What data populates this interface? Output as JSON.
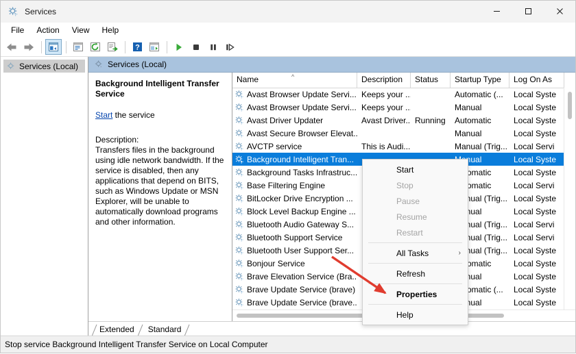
{
  "window": {
    "title": "Services",
    "icon": "services-gear-icon",
    "minimize_label": "Minimize",
    "maximize_label": "Maximize",
    "close_label": "Close"
  },
  "menubar": {
    "items": [
      {
        "label": "File"
      },
      {
        "label": "Action"
      },
      {
        "label": "View"
      },
      {
        "label": "Help"
      }
    ]
  },
  "toolbar": {
    "buttons": [
      {
        "name": "back-icon",
        "title": "Back"
      },
      {
        "name": "forward-icon",
        "title": "Forward"
      },
      {
        "name": "show-hide-tree-icon",
        "title": "Show/Hide Console Tree"
      },
      {
        "name": "properties-icon",
        "title": "Properties"
      },
      {
        "name": "refresh-icon",
        "title": "Refresh"
      },
      {
        "name": "export-list-icon",
        "title": "Export List"
      },
      {
        "name": "help-icon",
        "title": "Help"
      },
      {
        "name": "show-action-pane-icon",
        "title": "Show/Hide Action Pane"
      },
      {
        "name": "start-service-icon",
        "title": "Start Service"
      },
      {
        "name": "stop-service-icon",
        "title": "Stop Service"
      },
      {
        "name": "pause-service-icon",
        "title": "Pause Service"
      },
      {
        "name": "restart-service-icon",
        "title": "Restart Service"
      }
    ]
  },
  "tree": {
    "root_label": "Services (Local)"
  },
  "pane_header": {
    "label": "Services (Local)"
  },
  "detail": {
    "title": "Background Intelligent Transfer Service",
    "action_link": "Start",
    "action_suffix": " the service",
    "description_label": "Description:",
    "description": "Transfers files in the background using idle network bandwidth. If the service is disabled, then any applications that depend on BITS, such as Windows Update or MSN Explorer, will be unable to automatically download programs and other information."
  },
  "list": {
    "columns": [
      {
        "key": "name",
        "label": "Name",
        "sorted": "asc"
      },
      {
        "key": "description",
        "label": "Description"
      },
      {
        "key": "status",
        "label": "Status"
      },
      {
        "key": "startup",
        "label": "Startup Type"
      },
      {
        "key": "logon",
        "label": "Log On As"
      }
    ],
    "rows": [
      {
        "name": "Avast Browser Update Servi...",
        "description": "Keeps your ...",
        "status": "",
        "startup": "Automatic (...",
        "logon": "Local Syste",
        "selected": false
      },
      {
        "name": "Avast Browser Update Servi...",
        "description": "Keeps your ...",
        "status": "",
        "startup": "Manual",
        "logon": "Local Syste",
        "selected": false
      },
      {
        "name": "Avast Driver Updater",
        "description": "Avast Driver...",
        "status": "Running",
        "startup": "Automatic",
        "logon": "Local Syste",
        "selected": false
      },
      {
        "name": "Avast Secure Browser Elevat...",
        "description": "",
        "status": "",
        "startup": "Manual",
        "logon": "Local Syste",
        "selected": false
      },
      {
        "name": "AVCTP service",
        "description": "This is Audi...",
        "status": "",
        "startup": "Manual (Trig...",
        "logon": "Local Servi",
        "selected": false
      },
      {
        "name": "Background Intelligent Tran...",
        "description": "",
        "status": "",
        "startup": "Manual",
        "logon": "Local Syste",
        "selected": true
      },
      {
        "name": "Background Tasks Infrastruc...",
        "description": "",
        "status": "",
        "startup": "Automatic",
        "logon": "Local Syste",
        "selected": false
      },
      {
        "name": "Base Filtering Engine",
        "description": "",
        "status": "",
        "startup": "Automatic",
        "logon": "Local Servi",
        "selected": false
      },
      {
        "name": "BitLocker Drive Encryption ...",
        "description": "",
        "status": "",
        "startup": "Manual (Trig...",
        "logon": "Local Syste",
        "selected": false
      },
      {
        "name": "Block Level Backup Engine ...",
        "description": "",
        "status": "",
        "startup": "Manual",
        "logon": "Local Syste",
        "selected": false
      },
      {
        "name": "Bluetooth Audio Gateway S...",
        "description": "",
        "status": "",
        "startup": "Manual (Trig...",
        "logon": "Local Servi",
        "selected": false
      },
      {
        "name": "Bluetooth Support Service",
        "description": "",
        "status": "",
        "startup": "Manual (Trig...",
        "logon": "Local Servi",
        "selected": false
      },
      {
        "name": "Bluetooth User Support Ser...",
        "description": "",
        "status": "",
        "startup": "Manual (Trig...",
        "logon": "Local Syste",
        "selected": false
      },
      {
        "name": "Bonjour Service",
        "description": "",
        "status": "",
        "startup": "Automatic",
        "logon": "Local Syste",
        "selected": false
      },
      {
        "name": "Brave Elevation Service (Bra...",
        "description": "",
        "status": "",
        "startup": "Manual",
        "logon": "Local Syste",
        "selected": false
      },
      {
        "name": "Brave Update Service (brave)",
        "description": "",
        "status": "",
        "startup": "Automatic (...",
        "logon": "Local Syste",
        "selected": false
      },
      {
        "name": "Brave Update Service (brave...",
        "description": "",
        "status": "",
        "startup": "Manual",
        "logon": "Local Syste",
        "selected": false
      }
    ]
  },
  "context_menu": {
    "items": [
      {
        "label": "Start",
        "disabled": false,
        "bold": false,
        "submenu": false
      },
      {
        "label": "Stop",
        "disabled": true,
        "bold": false,
        "submenu": false
      },
      {
        "label": "Pause",
        "disabled": true,
        "bold": false,
        "submenu": false
      },
      {
        "label": "Resume",
        "disabled": true,
        "bold": false,
        "submenu": false
      },
      {
        "label": "Restart",
        "disabled": true,
        "bold": false,
        "submenu": false
      },
      {
        "separator": true
      },
      {
        "label": "All Tasks",
        "disabled": false,
        "bold": false,
        "submenu": true
      },
      {
        "separator": true
      },
      {
        "label": "Refresh",
        "disabled": false,
        "bold": false,
        "submenu": false
      },
      {
        "separator": true
      },
      {
        "label": "Properties",
        "disabled": false,
        "bold": true,
        "submenu": false
      },
      {
        "separator": true
      },
      {
        "label": "Help",
        "disabled": false,
        "bold": false,
        "submenu": false
      }
    ],
    "submenu_arrow": "›"
  },
  "tabs": [
    {
      "label": "Extended",
      "active": false
    },
    {
      "label": "Standard",
      "active": true
    }
  ],
  "statusbar": {
    "text": "Stop service Background Intelligent Transfer Service on Local Computer"
  },
  "annotation": {
    "name": "red-arrow-to-properties",
    "color": "#e03c2f"
  },
  "colors": {
    "selection_blue": "#0a7ddb",
    "pane_header_blue": "#a9c3de",
    "link_blue": "#0645ad",
    "window_chrome": "#f3f3f3"
  }
}
